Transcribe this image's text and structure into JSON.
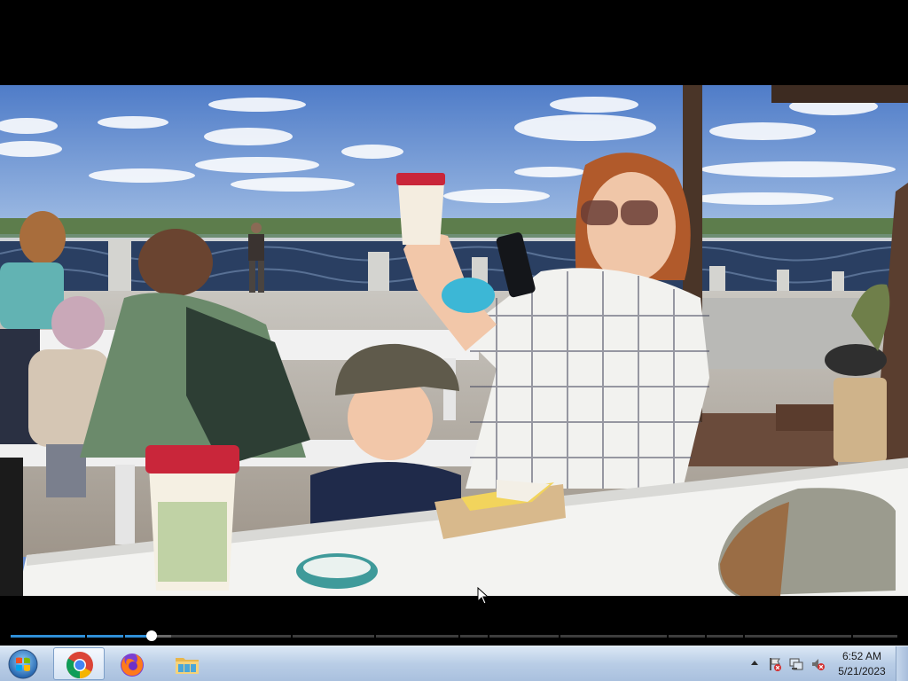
{
  "video": {
    "scene": "family at outdoor riverside table taking a selfie",
    "progress": 0.159,
    "buffered": 0.181,
    "chapter_marks": [
      0.084,
      0.127,
      0.316,
      0.41,
      0.505,
      0.538,
      0.618,
      0.74,
      0.783,
      0.826,
      0.948
    ]
  },
  "taskbar": {
    "start_icon": "windows-start-orb",
    "pinned": [
      {
        "name": "chrome-icon",
        "active": true
      },
      {
        "name": "firefox-icon",
        "active": false
      },
      {
        "name": "folder-icon",
        "active": false
      }
    ],
    "tray": {
      "icons": [
        "show-hidden-icons",
        "action-center-icon",
        "network-icon",
        "volume-muted-icon"
      ],
      "time": "6:52 AM",
      "date": "5/21/2023"
    }
  },
  "colors": {
    "seek_played": "#2f8fd8",
    "taskbar_top": "#dbe7f5",
    "taskbar_bottom": "#a9c0de"
  }
}
